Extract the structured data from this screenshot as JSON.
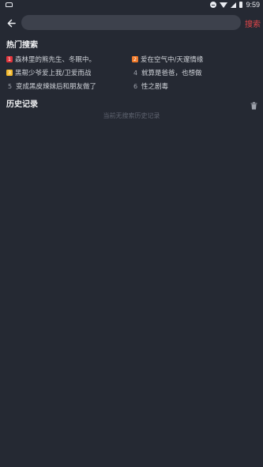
{
  "status_bar": {
    "time": "9:59"
  },
  "search": {
    "value": "",
    "placeholder": "",
    "action_label": "搜索"
  },
  "hot": {
    "title": "热门搜索",
    "items": [
      {
        "rank": "1",
        "text": "森林里的熊先生、冬眠中。",
        "badge_color": "#e0353c"
      },
      {
        "rank": "2",
        "text": "爱在空气中/天邃情缘",
        "badge_color": "#f07a2a"
      },
      {
        "rank": "3",
        "text": "黑帮少爷爱上我/卫爱而战",
        "badge_color": "#f3b92c"
      },
      {
        "rank": "4",
        "text": "就算是爸爸，也想做"
      },
      {
        "rank": "5",
        "text": "变成黑皮辣妹后和朋友做了"
      },
      {
        "rank": "6",
        "text": "性之剧毒"
      }
    ]
  },
  "history": {
    "title": "历史记录",
    "empty_text": "当前无搜索历史记录"
  },
  "icons": {
    "back": "arrow-left-icon",
    "trash": "trash-icon"
  },
  "colors": {
    "background": "#252933",
    "accent": "#e1464a",
    "search_box": "#3d414c"
  }
}
